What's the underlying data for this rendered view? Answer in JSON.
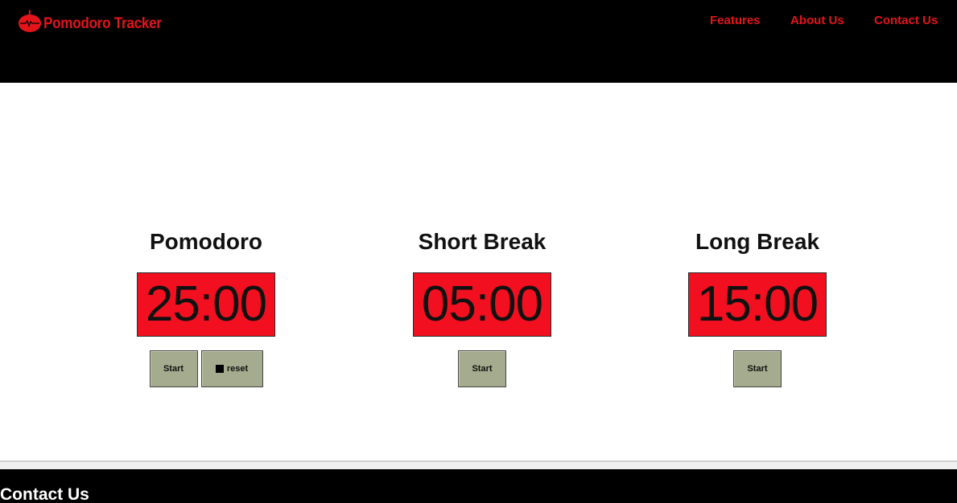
{
  "header": {
    "logo_text": "Pomodoro Tracker",
    "logo_icon": "tomato-icon",
    "nav": [
      "Features",
      "About Us",
      "Contact Us"
    ]
  },
  "timers": [
    {
      "title": "Pomodoro",
      "time": "25:00",
      "start_label": "Start",
      "reset_label": "reset"
    },
    {
      "title": "Short Break",
      "time": "05:00",
      "start_label": "Start"
    },
    {
      "title": "Long Break",
      "time": "15:00",
      "start_label": "Start"
    }
  ],
  "footer": {
    "title": "Contact Us"
  },
  "colors": {
    "header_bg": "#000000",
    "accent_red": "#e3151a",
    "timer_red": "#f20f1f",
    "button_bg": "#a4ab8e",
    "footer_text": "#ffffff"
  }
}
